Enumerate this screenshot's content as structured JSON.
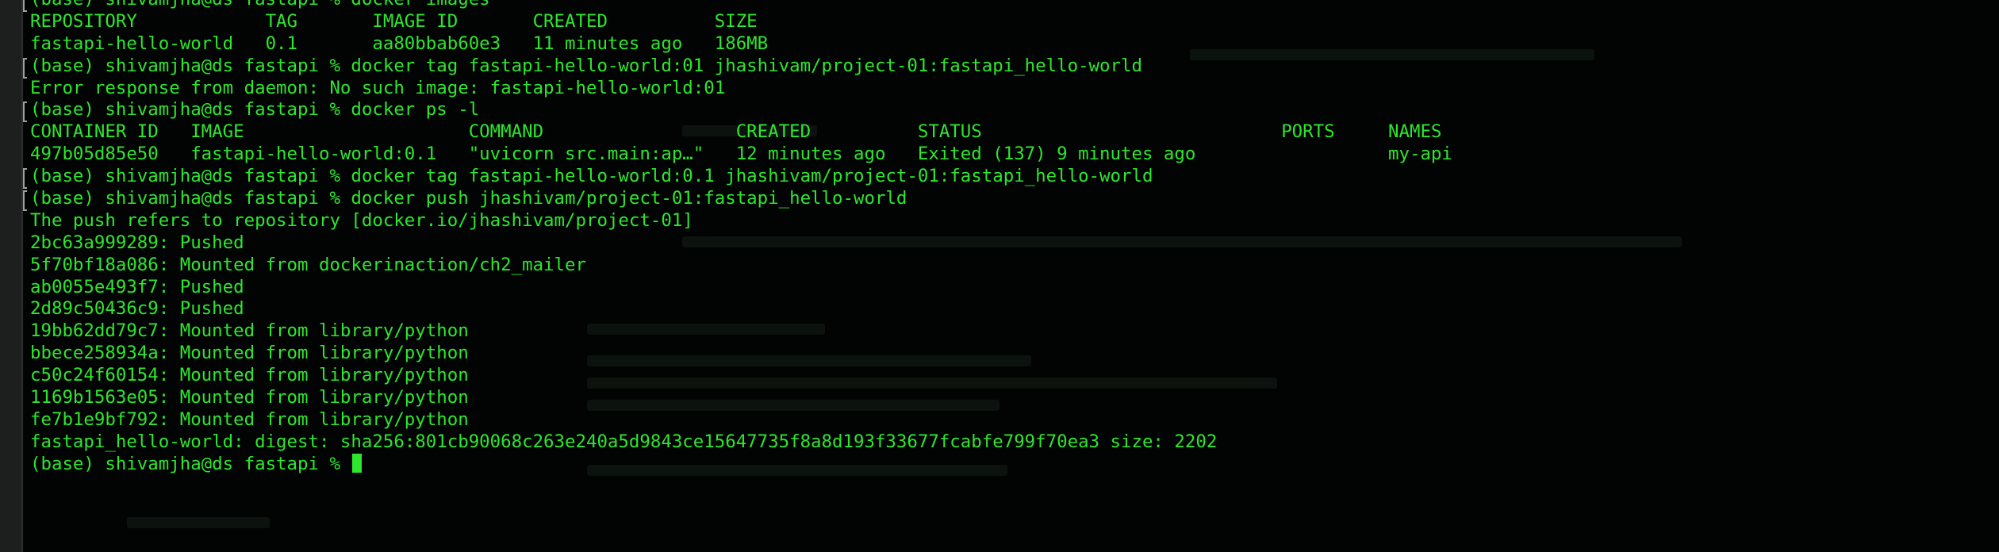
{
  "terminal": {
    "lines": [
      "(base) shivamjha@ds fastapi % docker images",
      "REPOSITORY            TAG       IMAGE ID       CREATED          SIZE",
      "fastapi-hello-world   0.1       aa80bbab60e3   11 minutes ago   186MB",
      "(base) shivamjha@ds fastapi % docker tag fastapi-hello-world:01 jhashivam/project-01:fastapi_hello-world",
      "Error response from daemon: No such image: fastapi-hello-world:01",
      "(base) shivamjha@ds fastapi % docker ps -l",
      "CONTAINER ID   IMAGE                     COMMAND                  CREATED          STATUS                            PORTS     NAMES",
      "497b05d85e50   fastapi-hello-world:0.1   \"uvicorn src.main:ap…\"   12 minutes ago   Exited (137) 9 minutes ago                  my-api",
      "(base) shivamjha@ds fastapi % docker tag fastapi-hello-world:0.1 jhashivam/project-01:fastapi_hello-world",
      "(base) shivamjha@ds fastapi % docker push jhashivam/project-01:fastapi_hello-world",
      "The push refers to repository [docker.io/jhashivam/project-01]",
      "2bc63a999289: Pushed",
      "5f70bf18a086: Mounted from dockerinaction/ch2_mailer",
      "ab0055e493f7: Pushed",
      "2d89c50436c9: Pushed",
      "19bb62dd79c7: Mounted from library/python",
      "bbece258934a: Mounted from library/python",
      "c50c24f60154: Mounted from library/python",
      "1169b1563e05: Mounted from library/python",
      "fe7b1e9bf792: Mounted from library/python",
      "fastapi_hello-world: digest: sha256:801cb90068c263e240a5d9843ce15647735f8a8d193f33677fcabfe799f70ea3 size: 2202",
      "(base) shivamjha@ds fastapi % "
    ]
  },
  "colors": {
    "background": "#020403",
    "text": "#2ee62e",
    "cursor": "#2ee62e"
  }
}
